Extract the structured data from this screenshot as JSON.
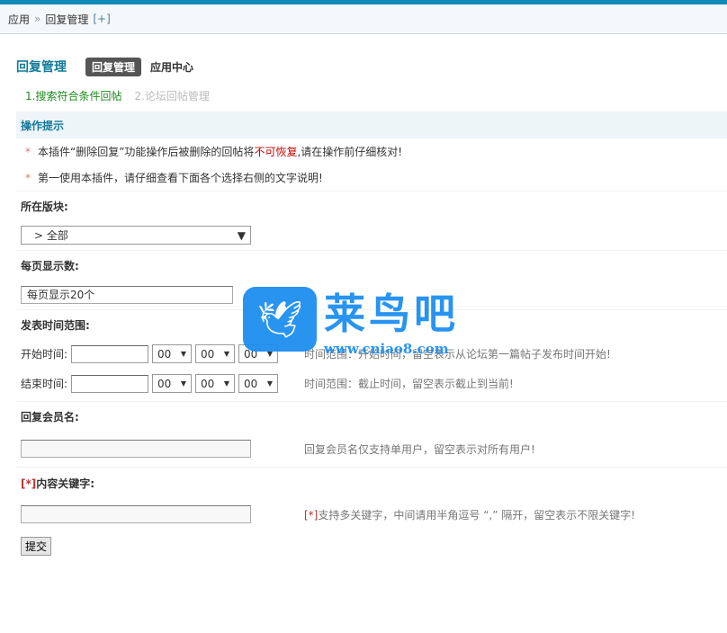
{
  "breadcrumb": {
    "root": "应用",
    "sep": "»",
    "current": "回复管理",
    "plus": "[+]"
  },
  "header": {
    "title": "回复管理",
    "tab_active": "回复管理",
    "tab": "应用中心"
  },
  "steps": [
    "1.搜索符合条件回帖",
    "2.论坛回帖管理"
  ],
  "tips": {
    "title": "操作提示",
    "bullet": "*",
    "line1_a": "本插件“删除回复”功能操作后被删除的回帖将",
    "line1_red": "不可恢复",
    "line1_b": ",请在操作前仔细核对!",
    "line2": "第一使用本插件，请仔细查看下面各个选择右侧的文字说明!"
  },
  "forum": {
    "label": "所在版块:",
    "value": "> 全部"
  },
  "perpage": {
    "label": "每页显示数:",
    "value": "每页显示20个"
  },
  "time": {
    "label": "发表时间范围:",
    "start_label": "开始时间:",
    "end_label": "结束时间:",
    "h": "00",
    "m": "00",
    "s": "00",
    "start_hint": "时间范围：开始时间，留空表示从论坛第一篇帖子发布时间开始!",
    "end_hint": "时间范围：截止时间，留空表示截止到当前!"
  },
  "member": {
    "label": "回复会员名:",
    "value": "",
    "hint": "回复会员名仅支持单用户，留空表示对所有用户!"
  },
  "keyword": {
    "star": "[*]",
    "label": "内容关键字:",
    "value": "",
    "hint_star": "[*]",
    "hint": "支持多关键字，中间请用半角逗号 “,” 隔开，留空表示不限关键字!"
  },
  "submit": "提交",
  "watermark": {
    "name": "莱鸟吧",
    "url": "www.cniao8.com"
  }
}
